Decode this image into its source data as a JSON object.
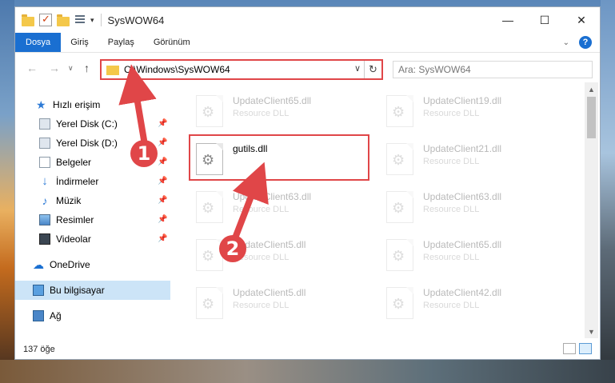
{
  "window": {
    "title": "SysWOW64",
    "minimize": "—",
    "maximize": "☐",
    "close": "✕"
  },
  "tabs": [
    "Dosya",
    "Giriş",
    "Paylaş",
    "Görünüm"
  ],
  "address": {
    "path": "C:\\Windows\\SysWOW64",
    "search_placeholder": "Ara: SysWOW64"
  },
  "nav": {
    "quick_access": "Hızlı erişim",
    "items": [
      "Yerel Disk (C:)",
      "Yerel Disk (D:)",
      "Belgeler",
      "İndirmeler",
      "Müzik",
      "Resimler",
      "Videolar"
    ],
    "onedrive": "OneDrive",
    "this_pc": "Bu bilgisayar",
    "network": "Ağ"
  },
  "files": [
    {
      "name": "UpdateClient65.dll",
      "type": "Resource DLL"
    },
    {
      "name": "UpdateClient19.dll",
      "type": "Resource DLL"
    },
    {
      "name": "gutils.dll",
      "type": ""
    },
    {
      "name": "UpdateClient21.dll",
      "type": "Resource DLL"
    },
    {
      "name": "UpdateClient63.dll",
      "type": "Resource DLL"
    },
    {
      "name": "UpdateClient63.dll",
      "type": "Resource DLL"
    },
    {
      "name": "UpdateClient5.dll",
      "type": "Resource DLL"
    },
    {
      "name": "UpdateClient65.dll",
      "type": "Resource DLL"
    },
    {
      "name": "UpdateClient5.dll",
      "type": "Resource DLL"
    },
    {
      "name": "UpdateClient42.dll",
      "type": "Resource DLL"
    }
  ],
  "status": {
    "count": "137 öğe"
  },
  "annotations": {
    "step1": "1",
    "step2": "2",
    "color": "#e04648"
  }
}
